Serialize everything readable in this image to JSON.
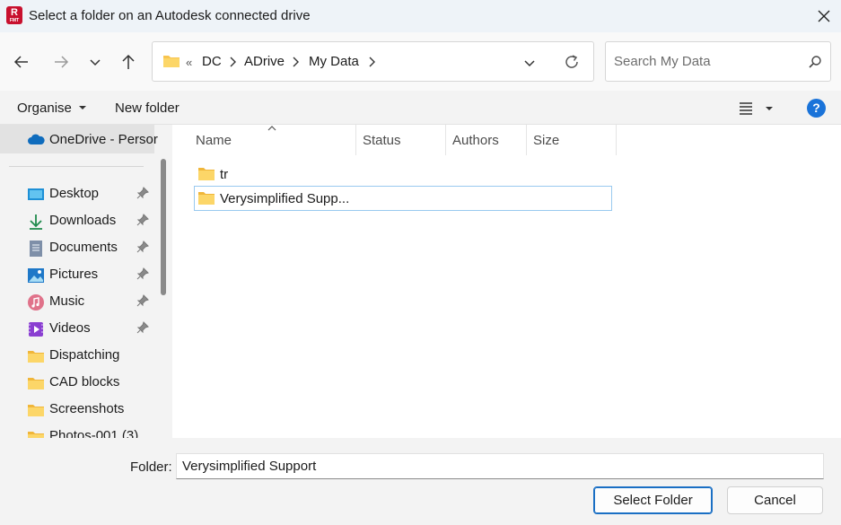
{
  "window": {
    "title": "Select a folder on an Autodesk connected drive",
    "app_icon_letter": "R",
    "app_icon_sub": "FMT"
  },
  "address_bar": {
    "overflow": "«",
    "breadcrumbs": [
      "DC",
      "ADrive",
      "My Data"
    ]
  },
  "search": {
    "placeholder": "Search My Data"
  },
  "toolbar": {
    "organise_label": "Organise",
    "new_folder_label": "New folder",
    "help_label": "?"
  },
  "sidebar": {
    "onedrive_label": "OneDrive - Persor",
    "items": [
      {
        "label": "Desktop",
        "icon": "desktop-icon",
        "pinned": true
      },
      {
        "label": "Downloads",
        "icon": "downloads-icon",
        "pinned": true
      },
      {
        "label": "Documents",
        "icon": "documents-icon",
        "pinned": true
      },
      {
        "label": "Pictures",
        "icon": "pictures-icon",
        "pinned": true
      },
      {
        "label": "Music",
        "icon": "music-icon",
        "pinned": true
      },
      {
        "label": "Videos",
        "icon": "videos-icon",
        "pinned": true
      },
      {
        "label": "Dispatching",
        "icon": "folder-icon",
        "pinned": false
      },
      {
        "label": "CAD blocks",
        "icon": "folder-icon",
        "pinned": false
      },
      {
        "label": "Screenshots",
        "icon": "folder-icon",
        "pinned": false
      },
      {
        "label": "Photos-001 (3)",
        "icon": "folder-icon",
        "pinned": false
      }
    ]
  },
  "columns": [
    "Name",
    "Status",
    "Authors",
    "Size"
  ],
  "files": [
    {
      "name": "tr",
      "selected": false
    },
    {
      "name": "Verysimplified Supp...",
      "selected": true
    }
  ],
  "footer": {
    "folder_label": "Folder:",
    "folder_value": "Verysimplified Support",
    "select_button": "Select Folder",
    "cancel_button": "Cancel"
  },
  "colors": {
    "accent": "#1a6fc4",
    "folder": "#f8c44f",
    "help": "#1a73d9"
  }
}
